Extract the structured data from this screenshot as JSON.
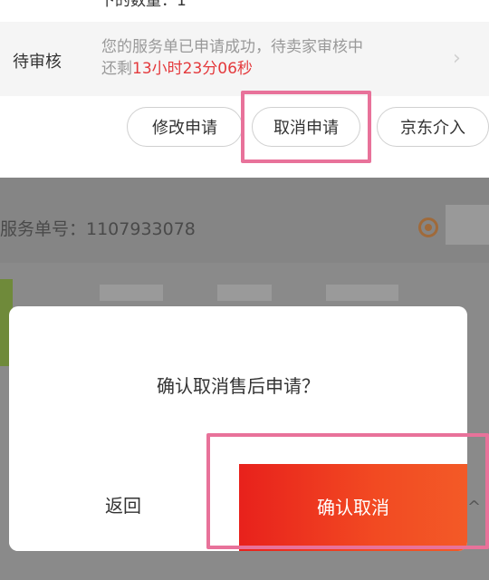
{
  "top": {
    "cutoff_text": "下的数量：1",
    "status_label": "待审核",
    "message_line1": "您的服务单已申请成功，待卖家审核中",
    "remaining_prefix": "还剩",
    "remaining_time": "13小时23分06秒",
    "buttons": {
      "modify": "修改申请",
      "cancel": "取消申请",
      "jd_intervene": "京东介入"
    }
  },
  "background": {
    "order_number": "服务单号：1107933078"
  },
  "dialog": {
    "message": "确认取消售后申请？",
    "back_label": "返回",
    "confirm_label": "确认取消"
  },
  "colors": {
    "accent_red": "#e4393c",
    "confirm_gradient_start": "#e8211c",
    "confirm_gradient_end": "#f35a27",
    "highlight_pink": "#e8729a",
    "overlay_gray": "#8a8a8a"
  },
  "icons": [
    "chevron-right-icon",
    "order-status-icon",
    "chevron-up-icon"
  ]
}
